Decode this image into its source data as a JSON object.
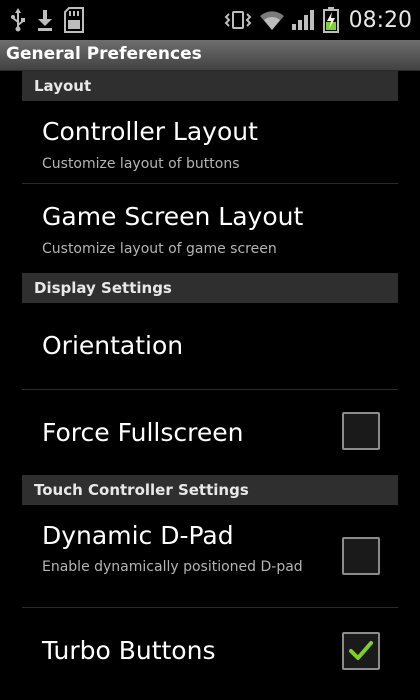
{
  "status_bar": {
    "time": "08:20",
    "left_icons": [
      "usb-icon",
      "download-icon",
      "sd-card-icon"
    ],
    "right_icons": [
      "vibrate-icon",
      "wifi-icon",
      "signal-icon",
      "battery-charging-icon"
    ]
  },
  "title_bar": {
    "title": "General Preferences"
  },
  "sections": [
    {
      "header": "Layout",
      "items": [
        {
          "title": "Controller Layout",
          "summary": "Customize layout of buttons"
        },
        {
          "title": "Game Screen Layout",
          "summary": "Customize layout of game screen"
        }
      ]
    },
    {
      "header": "Display Settings",
      "items": [
        {
          "title": "Orientation"
        },
        {
          "title": "Force Fullscreen",
          "checked": false
        }
      ]
    },
    {
      "header": "Touch Controller Settings",
      "items": [
        {
          "title": "Dynamic D-Pad",
          "summary": "Enable dynamically positioned D-pad",
          "checked": false
        },
        {
          "title": "Turbo Buttons",
          "checked": true
        }
      ]
    }
  ],
  "colors": {
    "check_mark": "#7ed321",
    "section_header_bg": "#2f2f2f",
    "summary_text": "#b4b4b4"
  }
}
